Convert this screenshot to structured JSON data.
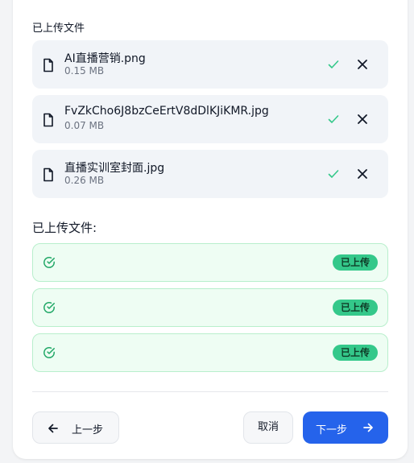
{
  "uploaded_section": {
    "title": "已上传文件",
    "files": [
      {
        "name": "AI直播营销.png",
        "size": "0.15 MB"
      },
      {
        "name": "FvZkCho6J8bzCeErtV8dDlKJiKMR.jpg",
        "size": "0.07 MB"
      },
      {
        "name": "直播实训室封面.jpg",
        "size": "0.26 MB"
      }
    ]
  },
  "uploaded_status": {
    "title": "已上传文件:",
    "items": [
      {
        "badge": "已上传"
      },
      {
        "badge": "已上传"
      },
      {
        "badge": "已上传"
      }
    ]
  },
  "actions": {
    "prev_label": "上一步",
    "cancel_label": "取消",
    "next_label": "下一步"
  },
  "colors": {
    "primary": "#2563eb",
    "success": "#34c88a",
    "success_bg": "#eefdf3",
    "item_bg": "#f1f4f8"
  }
}
